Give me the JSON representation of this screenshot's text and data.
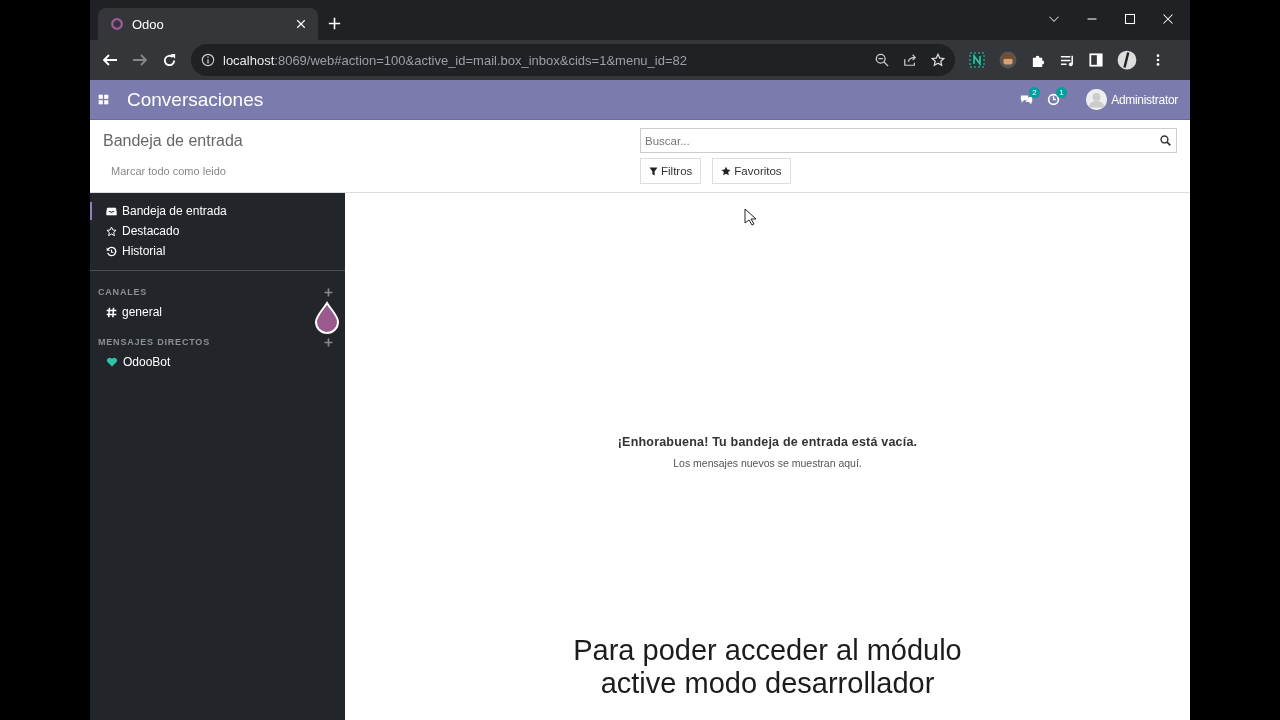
{
  "browser": {
    "tab": {
      "title": "Odoo",
      "selected": true
    },
    "url_host": "localhost",
    "url_rest": ":8069/web#action=100&active_id=mail.box_inbox&cids=1&menu_id=82"
  },
  "navbar": {
    "app_title": "Conversaciones",
    "message_count": "2",
    "activity_count": "1",
    "user": "Administrator"
  },
  "control_panel": {
    "title": "Bandeja de entrada",
    "action": "Marcar todo como leido",
    "search": {
      "placeholder": "Buscar..."
    },
    "filters": [
      {
        "label": "Filtros",
        "kind": "filter"
      },
      {
        "label": "Favoritos",
        "kind": "favorite"
      }
    ]
  },
  "sidebar": {
    "mailboxes": [
      {
        "label": "Bandeja de entrada",
        "kind": "inbox",
        "selected": true
      },
      {
        "label": "Destacado",
        "kind": "starred",
        "selected": false
      },
      {
        "label": "Historial",
        "kind": "history",
        "selected": false
      }
    ],
    "sections": [
      {
        "title": "CANALES",
        "items": [
          {
            "label": "general",
            "kind": "channel"
          }
        ]
      },
      {
        "title": "MENSAJES DIRECTOS",
        "items": [
          {
            "label": "OdooBot",
            "kind": "bot"
          }
        ]
      }
    ]
  },
  "empty_state": {
    "title": "¡Enhorabuena! Tu bandeja de entrada está vacía.",
    "subtitle": "Los mensajes nuevos se muestran aquí."
  },
  "caption": [
    "Para poder acceder al módulo",
    "active modo desarrollador"
  ]
}
